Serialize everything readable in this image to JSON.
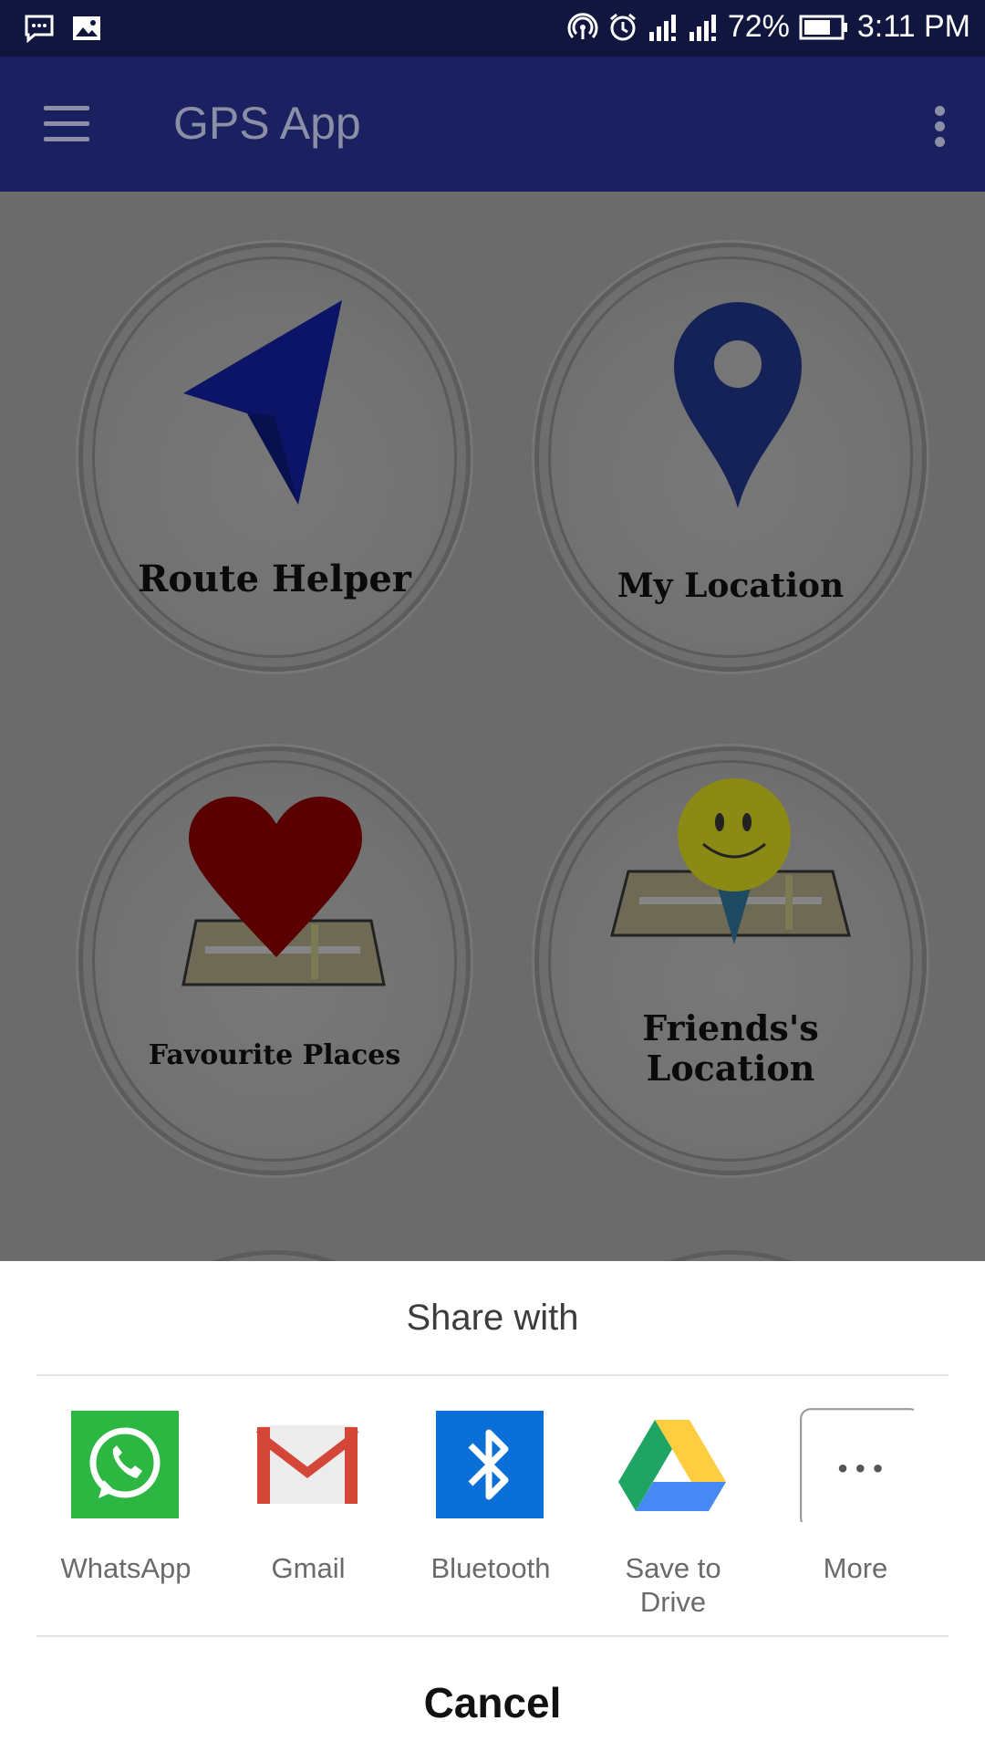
{
  "status_bar": {
    "battery": "72%",
    "time": "3:11 PM",
    "icons_left": [
      "message-icon",
      "image-icon"
    ],
    "icons_right": [
      "hotspot-icon",
      "alarm-icon",
      "signal-icon",
      "signal-icon",
      "battery-icon"
    ]
  },
  "app_bar": {
    "title": "GPS App",
    "menu_icon": "hamburger-icon",
    "overflow_icon": "more-vert-icon"
  },
  "tiles": [
    {
      "label": "Route Helper",
      "icon": "navigation-arrow-icon"
    },
    {
      "label": "My Location",
      "icon": "map-pin-icon"
    },
    {
      "label": "Favourite Places",
      "icon": "heart-map-icon"
    },
    {
      "label_line1": "Friends's",
      "label_line2": "Location",
      "icon": "smiley-map-icon"
    }
  ],
  "share_sheet": {
    "title": "Share with",
    "apps": [
      {
        "label": "WhatsApp",
        "icon": "whatsapp-icon",
        "color": "#2cb742"
      },
      {
        "label": "Gmail",
        "icon": "gmail-icon",
        "color": "#d44638"
      },
      {
        "label": "Bluetooth",
        "icon": "bluetooth-icon",
        "color": "#0a6fd6"
      },
      {
        "label_line1": "Save to",
        "label_line2": "Drive",
        "icon": "google-drive-icon"
      },
      {
        "label": "More",
        "icon": "more-horiz-icon"
      }
    ],
    "cancel": "Cancel"
  }
}
